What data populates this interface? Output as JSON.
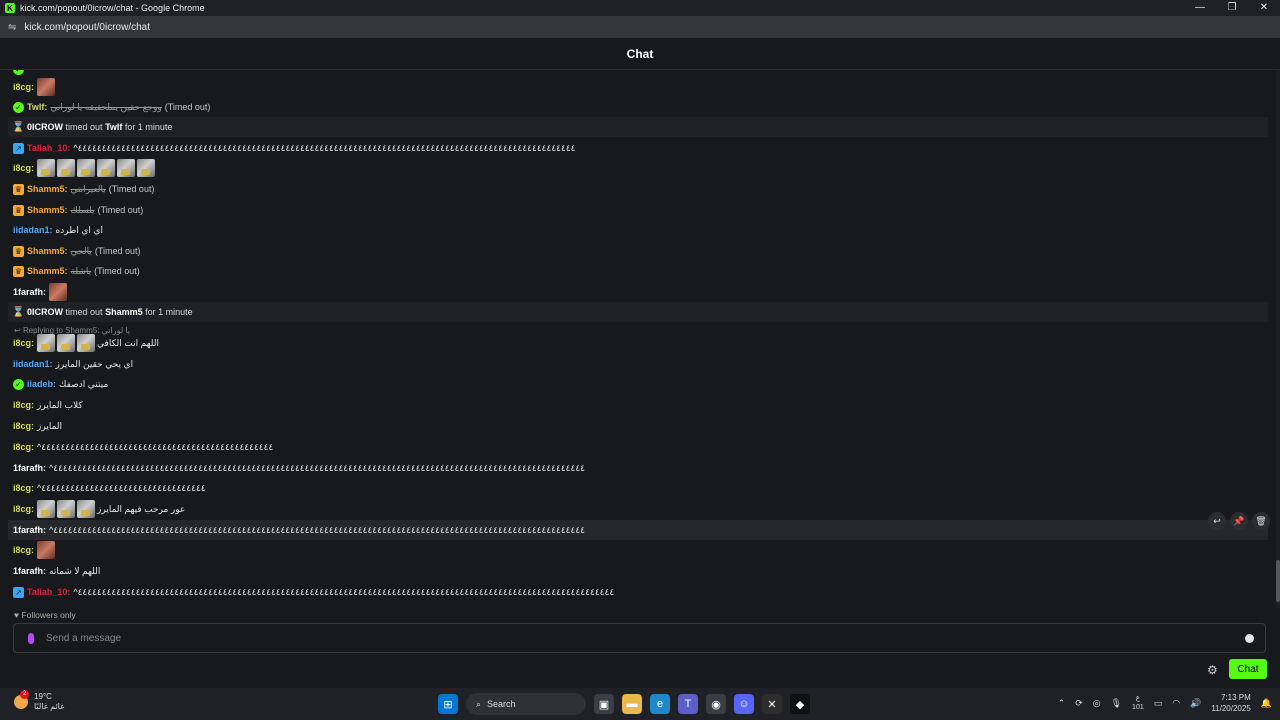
{
  "window": {
    "title": "kick.com/popout/0icrow/chat - Google Chrome",
    "url": "kick.com/popout/0icrow/chat",
    "controls": [
      "—",
      "❐",
      "✕"
    ]
  },
  "chat": {
    "header": "Chat",
    "messages": [
      {
        "user": "i8cg:",
        "text": ""
      },
      {
        "user": "Twlf:",
        "text": "ووجع حقين يملحقيقه يا لوراني",
        "timed_out": "(Timed out)"
      },
      {
        "actor": "0ICROW",
        "verb": "timed out",
        "target": "Twlf",
        "duration": "for 1 minute"
      },
      {
        "user": "Taliah_10:",
        "text": "^٤٤٤٤٤٤٤٤٤٤٤٤٤٤٤٤٤٤٤٤٤٤٤٤٤٤٤٤٤٤٤٤٤٤٤٤٤٤٤٤٤٤٤٤٤٤٤٤٤٤٤٤٤٤٤٤٤٤٤٤٤٤٤٤٤٤٤٤٤٤٤٤٤٤٤٤٤٤٤٤٤٤٤٤٤٤٤٤٤٤٤٤٤٤٤٤٤٤٤٤٤٤٤"
      },
      {
        "user": "i8cg:",
        "text": ""
      },
      {
        "user": "Shamm5:",
        "text": "يالعيرانتي",
        "timed_out": "(Timed out)"
      },
      {
        "user": "Shamm5:",
        "text": "يلسلك",
        "timed_out": "(Timed out)"
      },
      {
        "user": "iidadan1:",
        "text": "اي اي اطرده"
      },
      {
        "user": "Shamm5:",
        "text": "يالحي",
        "timed_out": "(Timed out)"
      },
      {
        "user": "Shamm5:",
        "text": "ياشلة",
        "timed_out": "(Timed out)"
      },
      {
        "user": "1farafh:",
        "text": ""
      },
      {
        "actor": "0ICROW",
        "verb": "timed out",
        "target": "Shamm5",
        "duration": "for 1 minute"
      },
      {
        "reply": "Replying to Shamm5: يا لوراني"
      },
      {
        "user": "i8cg:",
        "text": "اللهم انت الكافي"
      },
      {
        "user": "iidadan1:",
        "text": "اي يحي حقين المايرز"
      },
      {
        "user": "iiadeb:",
        "text": "ميتني ادصفك"
      },
      {
        "user": "i8cg:",
        "text": "كلاب المايرز"
      },
      {
        "user": "i8cg:",
        "text": "المايرز"
      },
      {
        "user": "i8cg:",
        "text": "^٤٤٤٤٤٤٤٤٤٤٤٤٤٤٤٤٤٤٤٤٤٤٤٤٤٤٤٤٤٤٤٤٤٤٤٤٤٤٤٤٤٤٤٤٤٤٤٤"
      },
      {
        "user": "1farafh:",
        "text": "^٤٤٤٤٤٤٤٤٤٤٤٤٤٤٤٤٤٤٤٤٤٤٤٤٤٤٤٤٤٤٤٤٤٤٤٤٤٤٤٤٤٤٤٤٤٤٤٤٤٤٤٤٤٤٤٤٤٤٤٤٤٤٤٤٤٤٤٤٤٤٤٤٤٤٤٤٤٤٤٤٤٤٤٤٤٤٤٤٤٤٤٤٤٤٤٤٤٤٤٤٤٤٤٤٤٤٤٤٤٤"
      },
      {
        "user": "i8cg:",
        "text": "^٤٤٤٤٤٤٤٤٤٤٤٤٤٤٤٤٤٤٤٤٤٤٤٤٤٤٤٤٤٤٤٤٤٤"
      },
      {
        "user": "i8cg:",
        "text": "عور مرحب فيهم المايرز"
      },
      {
        "user": "1farafh:",
        "text": "^٤٤٤٤٤٤٤٤٤٤٤٤٤٤٤٤٤٤٤٤٤٤٤٤٤٤٤٤٤٤٤٤٤٤٤٤٤٤٤٤٤٤٤٤٤٤٤٤٤٤٤٤٤٤٤٤٤٤٤٤٤٤٤٤٤٤٤٤٤٤٤٤٤٤٤٤٤٤٤٤٤٤٤٤٤٤٤٤٤٤٤٤٤٤٤٤٤٤٤٤٤٤٤٤٤٤٤٤٤٤"
      },
      {
        "user": "i8cg:",
        "text": ""
      },
      {
        "user": "1farafh:",
        "text": "اللهم لا شماته"
      },
      {
        "user": "Taliah_10:",
        "text": "^٤٤٤٤٤٤٤٤٤٤٤٤٤٤٤٤٤٤٤٤٤٤٤٤٤٤٤٤٤٤٤٤٤٤٤٤٤٤٤٤٤٤٤٤٤٤٤٤٤٤٤٤٤٤٤٤٤٤٤٤٤٤٤٤٤٤٤٤٤٤٤٤٤٤٤٤٤٤٤٤٤٤٤٤٤٤٤٤٤٤٤٤٤٤٤٤٤٤٤٤٤٤٤٤٤٤٤٤٤٤٤"
      }
    ],
    "followers_only": "Followers only",
    "input_placeholder": "Send a message",
    "send_label": "Chat"
  },
  "taskbar": {
    "weather_temp": "19°C",
    "weather_desc": "غائم غالبًا",
    "notification_count": "2",
    "search_label": "Search",
    "lang_top": "ع",
    "lang_bottom": "101",
    "time": "7:13 PM",
    "date": "11/20/2025"
  }
}
